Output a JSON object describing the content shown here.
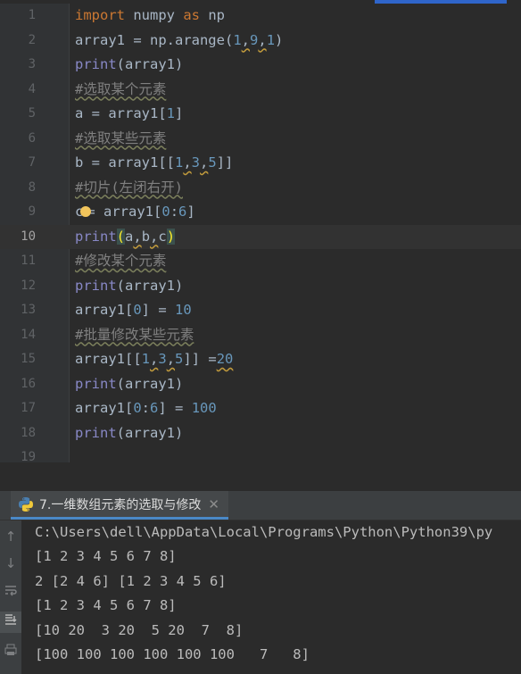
{
  "editor": {
    "lines": [
      {
        "num": "1"
      },
      {
        "num": "2"
      },
      {
        "num": "3"
      },
      {
        "num": "4"
      },
      {
        "num": "5"
      },
      {
        "num": "6"
      },
      {
        "num": "7"
      },
      {
        "num": "8"
      },
      {
        "num": "9"
      },
      {
        "num": "10"
      },
      {
        "num": "11"
      },
      {
        "num": "12"
      },
      {
        "num": "13"
      },
      {
        "num": "14"
      },
      {
        "num": "15"
      },
      {
        "num": "16"
      },
      {
        "num": "17"
      },
      {
        "num": "18"
      },
      {
        "num": "19"
      }
    ],
    "code": {
      "l1": {
        "kw1": "import",
        "t1": " numpy ",
        "kw2": "as",
        "t2": " np"
      },
      "l2": {
        "t1": "array1 = np.arange(",
        "n1": "1",
        "c1": ",",
        "n2": "9",
        "c2": ",",
        "n3": "1",
        "t2": ")"
      },
      "l3": {
        "fn": "print",
        "t1": "(array1)"
      },
      "l4": {
        "cm": "#选取某个元素"
      },
      "l5": {
        "t1": "a = array1[",
        "n1": "1",
        "t2": "]"
      },
      "l6": {
        "cm": "#选取某些元素"
      },
      "l7": {
        "t1": "b = array1[[",
        "n1": "1",
        "c1": ",",
        "n2": "3",
        "c2": ",",
        "n3": "5",
        "t2": "]]"
      },
      "l8": {
        "cm": "#切片(左闭右开)"
      },
      "l9": {
        "t1": "c",
        "t2": "= array1[",
        "n1": "0",
        "t3": ":",
        "n2": "6",
        "t4": "]"
      },
      "l10": {
        "fn": "print",
        "p1": "(",
        "t1": "a",
        "c1": ",",
        "t2": "b",
        "c2": ",",
        "t3": "c",
        "p2": ")"
      },
      "l11": {
        "cm": "#修改某个元素"
      },
      "l12": {
        "fn": "print",
        "t1": "(array1)"
      },
      "l13": {
        "t1": "array1[",
        "n1": "0",
        "t2": "] = ",
        "n2": "10"
      },
      "l14": {
        "cm": "#批量修改某些元素"
      },
      "l15": {
        "t1": "array1[[",
        "n1": "1",
        "c1": ",",
        "n2": "3",
        "c2": ",",
        "n3": "5",
        "t2": "]] =",
        "n4": "20"
      },
      "l16": {
        "fn": "print",
        "t1": "(array1)"
      },
      "l17": {
        "t1": "array1[",
        "n1": "0",
        "t2": ":",
        "n2": "6",
        "t3": "] = ",
        "n3": "100"
      },
      "l18": {
        "fn": "print",
        "t1": "(array1)"
      }
    }
  },
  "run_panel": {
    "tab_label": "7.一维数组元素的选取与修改",
    "tab_icon": "python-icon",
    "toolbar_icons": [
      "arrow-up-icon",
      "arrow-down-icon",
      "soft-wrap-icon",
      "scroll-to-end-icon",
      "print-icon"
    ],
    "output": [
      "C:\\Users\\dell\\AppData\\Local\\Programs\\Python\\Python39\\py",
      "[1 2 3 4 5 6 7 8]",
      "2 [2 4 6] [1 2 3 4 5 6]",
      "[1 2 3 4 5 6 7 8]",
      "[10 20  3 20  5 20  7  8]",
      "[100 100 100 100 100 100   7   8]"
    ]
  },
  "colors": {
    "background": "#2b2b2b",
    "keyword": "#cc7832",
    "builtin": "#8888c6",
    "number": "#6897bb",
    "comment": "#808080",
    "text": "#a9b7c6"
  }
}
